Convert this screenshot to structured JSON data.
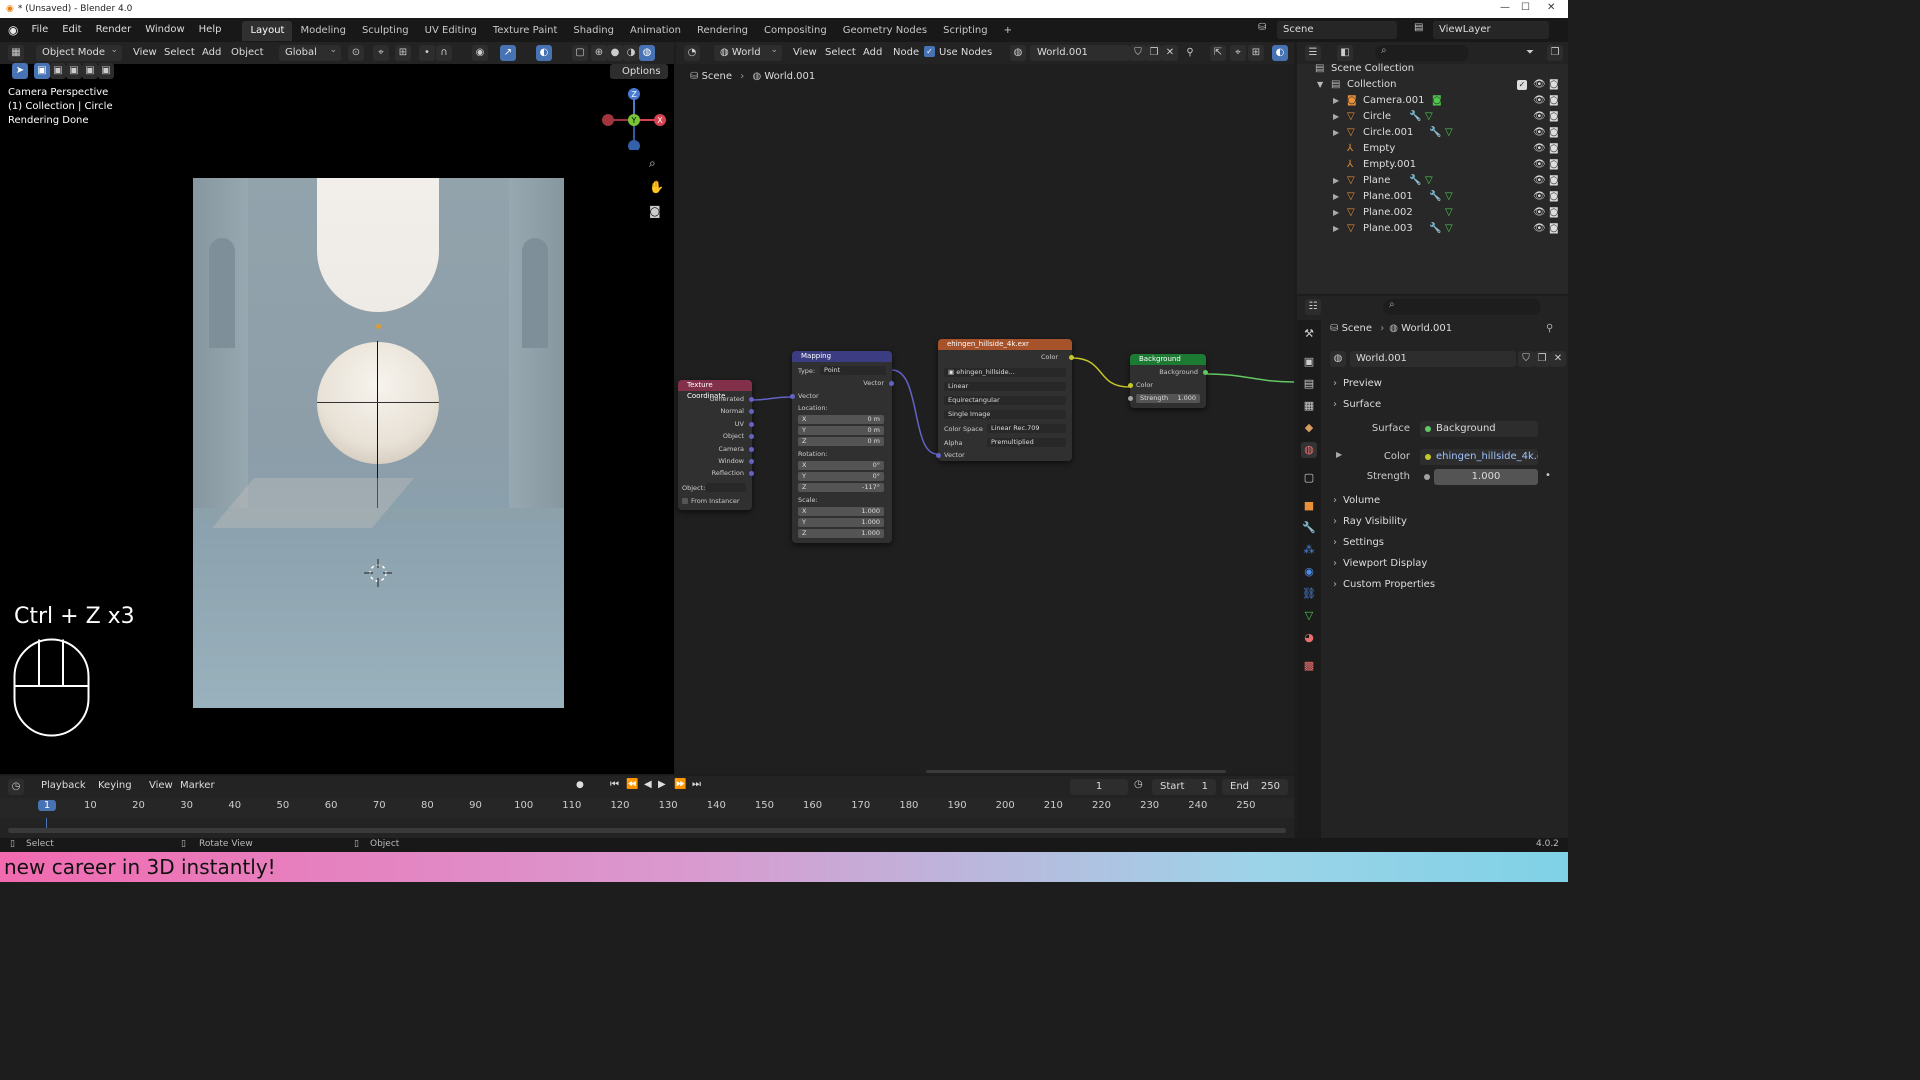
{
  "window": {
    "title": "* (Unsaved) - Blender 4.0"
  },
  "menu": [
    "File",
    "Edit",
    "Render",
    "Window",
    "Help"
  ],
  "workspaces": [
    "Layout",
    "Modeling",
    "Sculpting",
    "UV Editing",
    "Texture Paint",
    "Shading",
    "Animation",
    "Rendering",
    "Compositing",
    "Geometry Nodes",
    "Scripting"
  ],
  "active_workspace": "Layout",
  "scene": {
    "name": "Scene",
    "view_layer": "ViewLayer"
  },
  "viewport": {
    "mode": "Object Mode",
    "menus": [
      "View",
      "Select",
      "Add",
      "Object"
    ],
    "orientation": "Global",
    "options": "Options",
    "info": [
      "Camera Perspective",
      "(1) Collection | Circle",
      "Rendering Done"
    ],
    "shortcut": "Ctrl + Z x3",
    "gizmo": {
      "z": "Z",
      "y": "Y",
      "x": "X"
    }
  },
  "node_editor": {
    "type": "World",
    "menus": [
      "View",
      "Select",
      "Add",
      "Node"
    ],
    "use_nodes": "Use Nodes",
    "world": "World.001",
    "breadcrumb": [
      "Scene",
      "World.001"
    ]
  },
  "nodes": {
    "texcoord": {
      "title": "Texture Coordinate",
      "outputs": [
        "Generated",
        "Normal",
        "UV",
        "Object",
        "Camera",
        "Window",
        "Reflection"
      ],
      "object_label": "Object:",
      "from_instancer": "From Instancer"
    },
    "mapping": {
      "title": "Mapping",
      "type_label": "Type:",
      "type_value": "Point",
      "out": "Vector",
      "in": "Vector",
      "location": "Location:",
      "loc": [
        [
          "X",
          "0 m"
        ],
        [
          "Y",
          "0 m"
        ],
        [
          "Z",
          "0 m"
        ]
      ],
      "rotation": "Rotation:",
      "rot": [
        [
          "X",
          "0°"
        ],
        [
          "Y",
          "0°"
        ],
        [
          "Z",
          "-117°"
        ]
      ],
      "scale": "Scale:",
      "scl": [
        [
          "X",
          "1.000"
        ],
        [
          "Y",
          "1.000"
        ],
        [
          "Z",
          "1.000"
        ]
      ]
    },
    "envtex": {
      "title": "ehingen_hillside_4k.exr",
      "out": "Color",
      "image": "ehingen_hillside...",
      "interp": "Linear",
      "proj": "Equirectangular",
      "src": "Single Image",
      "cs_label": "Color Space",
      "cs": "Linear Rec.709",
      "alpha_label": "Alpha",
      "alpha": "Premultiplied",
      "in": "Vector"
    },
    "background": {
      "title": "Background",
      "out": "Background",
      "in_color": "Color",
      "strength_label": "Strength",
      "strength": "1.000"
    }
  },
  "outliner": {
    "root": "Scene Collection",
    "collection": "Collection",
    "items": [
      "Camera.001",
      "Circle",
      "Circle.001",
      "Empty",
      "Empty.001",
      "Plane",
      "Plane.001",
      "Plane.002",
      "Plane.003"
    ]
  },
  "properties": {
    "breadcrumb": [
      "Scene",
      "World.001"
    ],
    "world": "World.001",
    "sections": {
      "preview": "Preview",
      "surface": "Surface",
      "volume": "Volume",
      "ray": "Ray Visibility",
      "settings": "Settings",
      "viewport_display": "Viewport Display",
      "custom": "Custom Properties"
    },
    "surface_label": "Surface",
    "surface_value": "Background",
    "color_label": "Color",
    "color_value": "ehingen_hillside_4k.exr",
    "strength_label": "Strength",
    "strength_value": "1.000"
  },
  "timeline": {
    "menus": [
      "Playback",
      "Keying",
      "View",
      "Marker"
    ],
    "current": "1",
    "start_label": "Start",
    "start": "1",
    "end_label": "End",
    "end": "250",
    "ticks": [
      "1",
      "10",
      "20",
      "30",
      "40",
      "50",
      "60",
      "70",
      "80",
      "90",
      "100",
      "110",
      "120",
      "130",
      "140",
      "150",
      "160",
      "170",
      "180",
      "190",
      "200",
      "210",
      "220",
      "230",
      "240",
      "250"
    ]
  },
  "status": {
    "select": "Select",
    "rotate": "Rotate View",
    "object": "Object",
    "version": "4.0.2"
  },
  "banner": {
    "text": "new career in 3D instantly!"
  },
  "colors": {
    "accent": "#4772b3",
    "texcoord": "#83314a",
    "mapping": "#3c3c83",
    "envtex": "#a6522a",
    "background": "#1d7a32"
  }
}
